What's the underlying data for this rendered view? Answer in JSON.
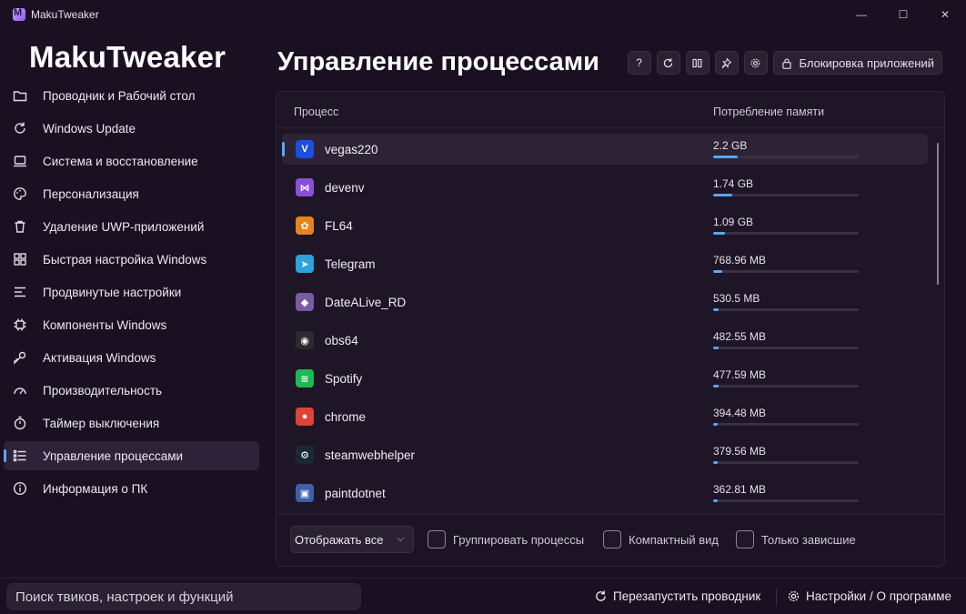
{
  "window": {
    "title": "MakuTweaker",
    "minimize": "—",
    "maximize": "☐",
    "close": "✕"
  },
  "sidebar": {
    "brand": "MakuTweaker",
    "items": [
      {
        "label": "Проводник и Рабочий стол",
        "icon": "folder-icon"
      },
      {
        "label": "Windows Update",
        "icon": "refresh-icon"
      },
      {
        "label": "Система и восстановление",
        "icon": "laptop-icon"
      },
      {
        "label": "Персонализация",
        "icon": "palette-icon"
      },
      {
        "label": "Удаление UWP-приложений",
        "icon": "trash-icon"
      },
      {
        "label": "Быстрая настройка Windows",
        "icon": "grid-icon"
      },
      {
        "label": "Продвинутые настройки",
        "icon": "lines-icon"
      },
      {
        "label": "Компоненты Windows",
        "icon": "chip-icon"
      },
      {
        "label": "Активация Windows",
        "icon": "key-icon"
      },
      {
        "label": "Производительность",
        "icon": "gauge-icon"
      },
      {
        "label": "Таймер выключения",
        "icon": "timer-icon"
      },
      {
        "label": "Управление процессами",
        "icon": "list-icon",
        "active": true
      },
      {
        "label": "Информация о ПК",
        "icon": "info-icon"
      }
    ]
  },
  "header": {
    "title": "Управление процессами",
    "help": "?",
    "block_label": "Блокировка приложений"
  },
  "table": {
    "col_process": "Процесс",
    "col_memory": "Потребление памяти",
    "rows": [
      {
        "name": "vegas220",
        "memory": "2.2 GB",
        "fraction": 0.17,
        "icon_color": "#1c4ee0",
        "glyph": "V"
      },
      {
        "name": "devenv",
        "memory": "1.74 GB",
        "fraction": 0.13,
        "icon_color": "#8a4fd8",
        "glyph": "⋈"
      },
      {
        "name": "FL64",
        "memory": "1.09 GB",
        "fraction": 0.08,
        "icon_color": "#e8821f",
        "glyph": "✿"
      },
      {
        "name": "Telegram",
        "memory": "768.96 MB",
        "fraction": 0.06,
        "icon_color": "#2aa3de",
        "glyph": "➤"
      },
      {
        "name": "DateALive_RD",
        "memory": "530.5 MB",
        "fraction": 0.04,
        "icon_color": "#7a5aa0",
        "glyph": "◆"
      },
      {
        "name": "obs64",
        "memory": "482.55 MB",
        "fraction": 0.037,
        "icon_color": "#2b2b2b",
        "glyph": "◉"
      },
      {
        "name": "Spotify",
        "memory": "477.59 MB",
        "fraction": 0.037,
        "icon_color": "#1db954",
        "glyph": "≋"
      },
      {
        "name": "chrome",
        "memory": "394.48 MB",
        "fraction": 0.03,
        "icon_color": "#db4437",
        "glyph": "●"
      },
      {
        "name": "steamwebhelper",
        "memory": "379.56 MB",
        "fraction": 0.03,
        "icon_color": "#1b2838",
        "glyph": "⚙"
      },
      {
        "name": "paintdotnet",
        "memory": "362.81 MB",
        "fraction": 0.028,
        "icon_color": "#3d5fa8",
        "glyph": "▣"
      }
    ]
  },
  "filters": {
    "display_value": "Отображать все",
    "group": "Группировать процессы",
    "compact": "Компактный вид",
    "hung": "Только зависшие"
  },
  "bottom": {
    "search_placeholder": "Поиск твиков, настроек и функций",
    "restart_explorer": "Перезапустить проводник",
    "settings": "Настройки / О программе"
  },
  "colors": {
    "accent": "#5aa7f5",
    "background": "#1a1022",
    "panel": "#1e1527"
  }
}
